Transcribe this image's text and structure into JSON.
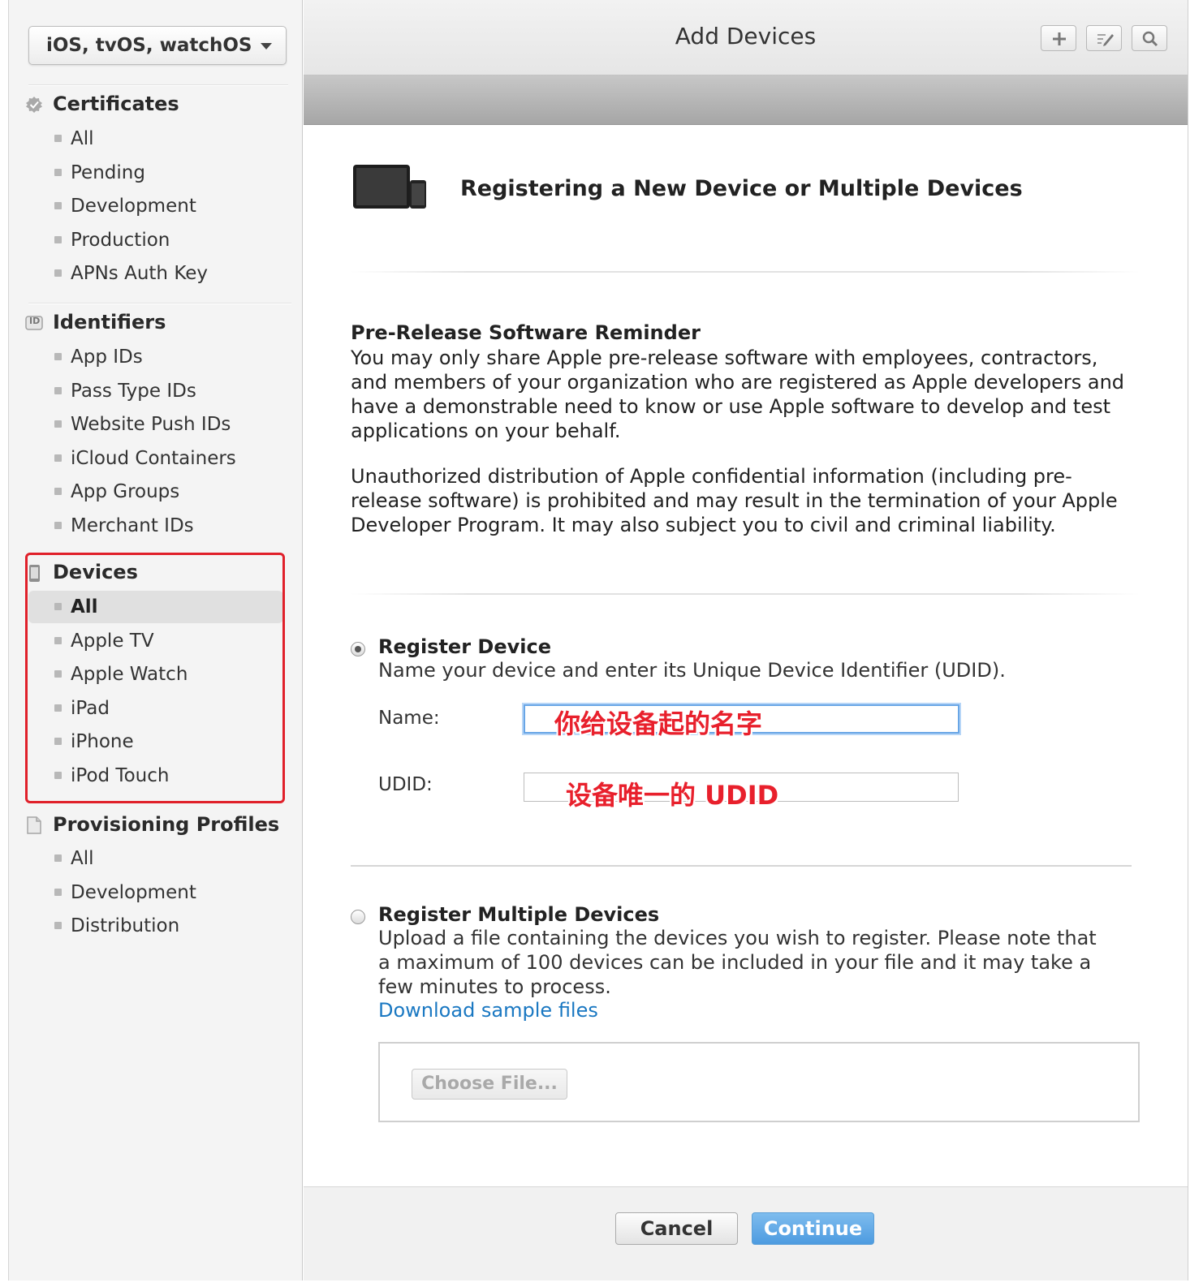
{
  "sidebar": {
    "platform": "iOS, tvOS, watchOS",
    "sections": [
      {
        "title": "Certificates",
        "icon": "certificate-icon",
        "items": [
          "All",
          "Pending",
          "Development",
          "Production",
          "APNs Auth Key"
        ]
      },
      {
        "title": "Identifiers",
        "icon": "id-icon",
        "icon_text": "ID",
        "items": [
          "App IDs",
          "Pass Type IDs",
          "Website Push IDs",
          "iCloud Containers",
          "App Groups",
          "Merchant IDs"
        ]
      },
      {
        "title": "Devices",
        "icon": "device-icon",
        "items": [
          "All",
          "Apple TV",
          "Apple Watch",
          "iPad",
          "iPhone",
          "iPod Touch"
        ],
        "active_item": "All"
      },
      {
        "title": "Provisioning Profiles",
        "icon": "document-icon",
        "items": [
          "All",
          "Development",
          "Distribution"
        ]
      }
    ]
  },
  "header": {
    "title": "Add Devices",
    "buttons": [
      "plus-icon",
      "edit-icon",
      "search-icon"
    ]
  },
  "main": {
    "page_title": "Registering a New Device or Multiple Devices",
    "reminder": {
      "title": "Pre-Release Software Reminder",
      "p1": "You may only share Apple pre-release software with employees, contractors, and members of your organization who are registered as Apple developers and have a demonstrable need to know or use Apple software to develop and test applications on your behalf.",
      "p2": "Unauthorized distribution of Apple confidential information (including pre-release software) is prohibited and may result in the termination of your Apple Developer Program. It may also subject you to civil and criminal liability."
    },
    "register_device": {
      "title": "Register Device",
      "description": "Name your device and enter its Unique Device Identifier (UDID).",
      "selected": true,
      "name_label": "Name:",
      "name_value": "",
      "udid_label": "UDID:",
      "udid_value": ""
    },
    "register_multiple": {
      "title": "Register Multiple Devices",
      "description": "Upload a file containing the devices you wish to register. Please note that a maximum of 100 devices can be included in your file and it may take a few minutes to process.",
      "selected": false,
      "link": "Download sample files",
      "choose_file": "Choose File..."
    },
    "annotations": {
      "name_hint": "你给设备起的名字",
      "udid_hint": "设备唯一的 UDID"
    }
  },
  "footer": {
    "cancel": "Cancel",
    "continue": "Continue"
  },
  "colors": {
    "accent": "#4d9be0",
    "link": "#1a78c2",
    "highlight": "#e0202a"
  }
}
